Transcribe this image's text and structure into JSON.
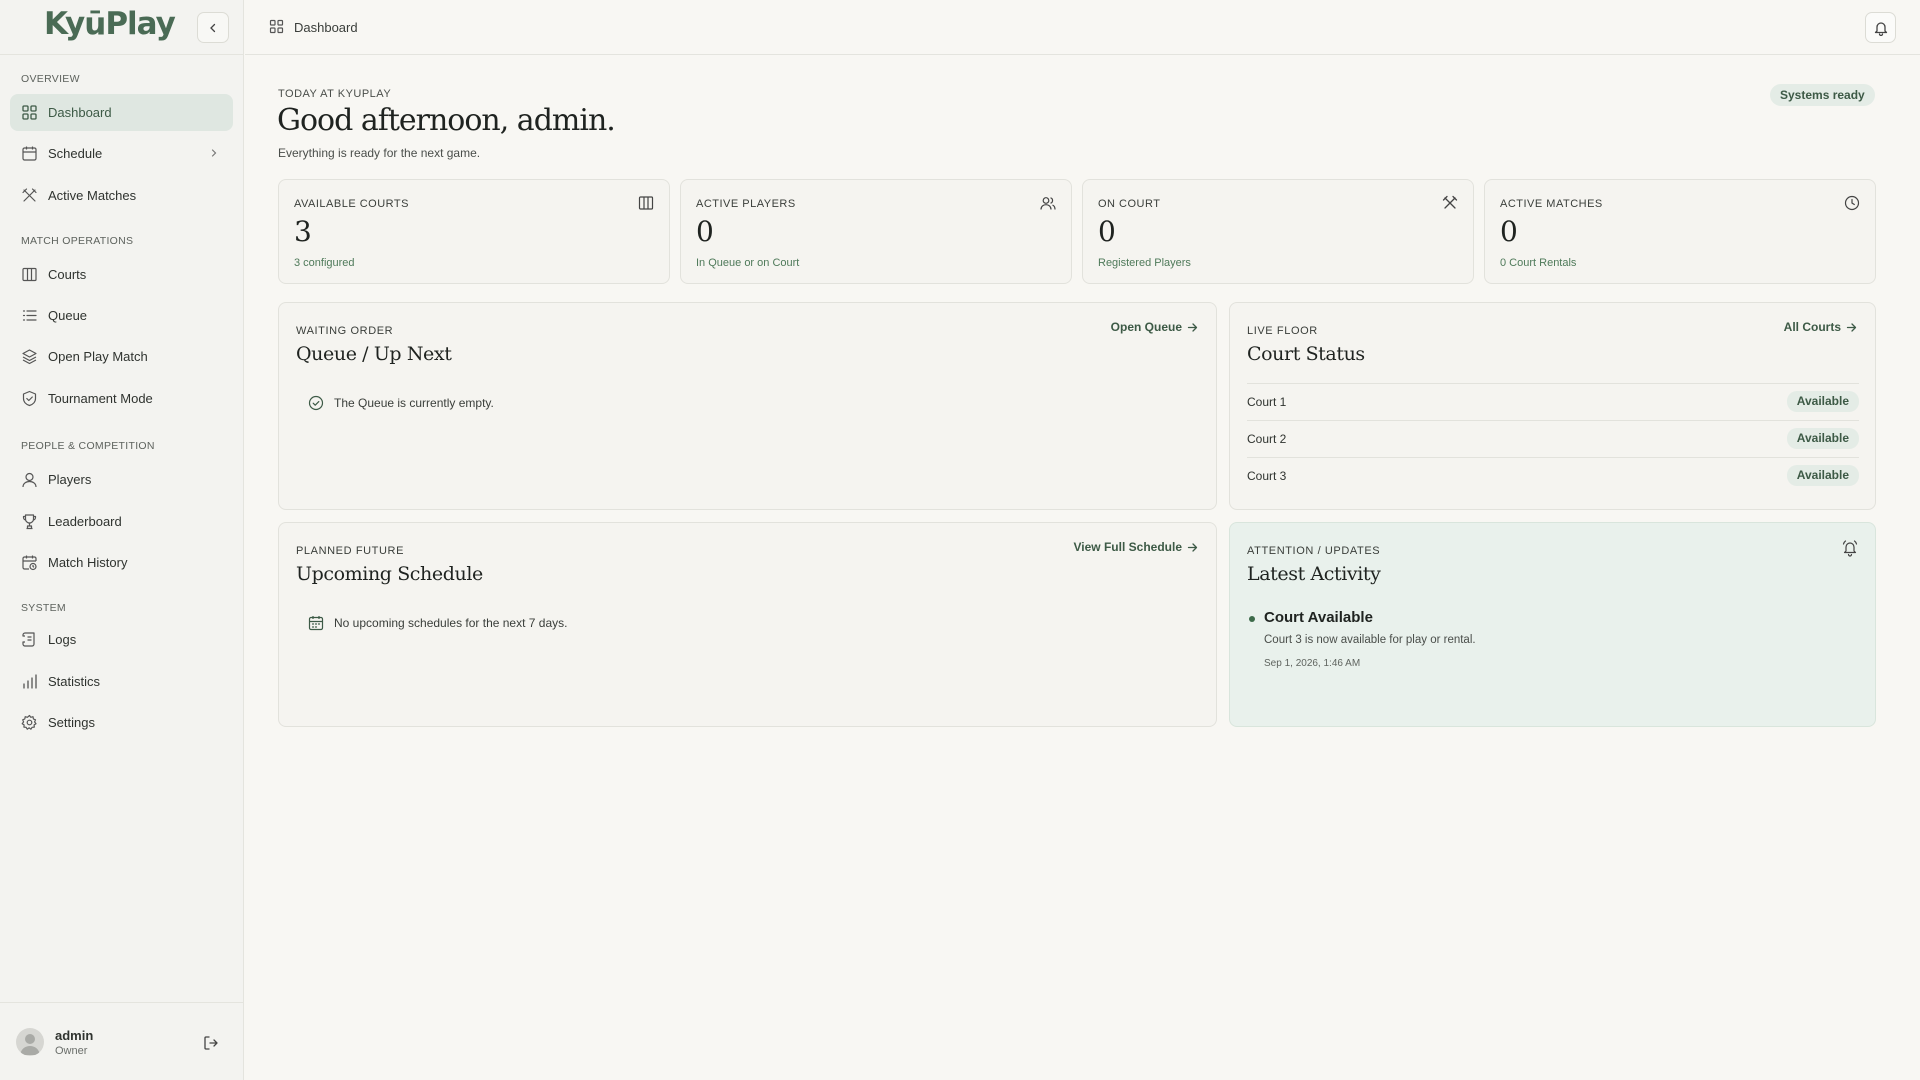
{
  "app": {
    "name": "KyūPlay"
  },
  "sidebar": {
    "sections": [
      {
        "label": "OVERVIEW"
      },
      {
        "label": "MATCH OPERATIONS"
      },
      {
        "label": "PEOPLE & COMPETITION"
      },
      {
        "label": "SYSTEM"
      }
    ],
    "items": [
      {
        "label": "Dashboard",
        "icon": "dashboard-grid-icon",
        "active": true
      },
      {
        "label": "Schedule",
        "icon": "calendar-icon"
      },
      {
        "label": "Active Matches",
        "icon": "crossed-paddles-icon"
      },
      {
        "label": "Courts",
        "icon": "court-columns-icon"
      },
      {
        "label": "Queue",
        "icon": "list-icon"
      },
      {
        "label": "Open Play Match",
        "icon": "layers-icon"
      },
      {
        "label": "Tournament Mode",
        "icon": "shield-check-icon"
      },
      {
        "label": "Players",
        "icon": "user-icon"
      },
      {
        "label": "Leaderboard",
        "icon": "trophy-icon"
      },
      {
        "label": "Match History",
        "icon": "calendar-clock-icon"
      },
      {
        "label": "Logs",
        "icon": "scroll-icon"
      },
      {
        "label": "Statistics",
        "icon": "bar-chart-icon"
      },
      {
        "label": "Settings",
        "icon": "gear-icon"
      }
    ],
    "user": {
      "name": "admin",
      "role": "Owner"
    }
  },
  "topbar": {
    "breadcrumb": "Dashboard"
  },
  "header": {
    "eyebrow": "TODAY AT KYUPLAY",
    "greeting": "Good afternoon, admin.",
    "subline": "Everything is ready for the next game.",
    "status": "Systems ready"
  },
  "stats": [
    {
      "label": "AVAILABLE COURTS",
      "value": "3",
      "sub": "3 configured",
      "icon": "court-columns-icon"
    },
    {
      "label": "ACTIVE PLAYERS",
      "value": "0",
      "sub": "In Queue or on Court",
      "icon": "users-icon"
    },
    {
      "label": "ON COURT",
      "value": "0",
      "sub": "Registered Players",
      "icon": "crossed-paddles-icon"
    },
    {
      "label": "ACTIVE MATCHES",
      "value": "0",
      "sub": "0 Court Rentals",
      "icon": "clock-icon"
    }
  ],
  "queue_panel": {
    "eyebrow": "WAITING ORDER",
    "title": "Queue / Up Next",
    "link": "Open Queue",
    "empty": "The Queue is currently empty."
  },
  "courts_panel": {
    "eyebrow": "LIVE FLOOR",
    "title": "Court Status",
    "link": "All Courts",
    "courts": [
      {
        "name": "Court 1",
        "status": "Available"
      },
      {
        "name": "Court 2",
        "status": "Available"
      },
      {
        "name": "Court 3",
        "status": "Available"
      }
    ]
  },
  "schedule_panel": {
    "eyebrow": "PLANNED FUTURE",
    "title": "Upcoming Schedule",
    "link": "View Full Schedule",
    "empty": "No upcoming schedules for the next 7 days."
  },
  "activity_panel": {
    "eyebrow": "ATTENTION / UPDATES",
    "title": "Latest Activity",
    "items": [
      {
        "title": "Court Available",
        "desc": "Court 3 is now available for play or rental.",
        "time": "Sep 1, 2026, 1:46 AM"
      }
    ]
  },
  "colors": {
    "accent": "#3d5a46",
    "background": "#f8f7f3",
    "sidebar": "#f3f3f0",
    "badge": "#e4ece6"
  }
}
